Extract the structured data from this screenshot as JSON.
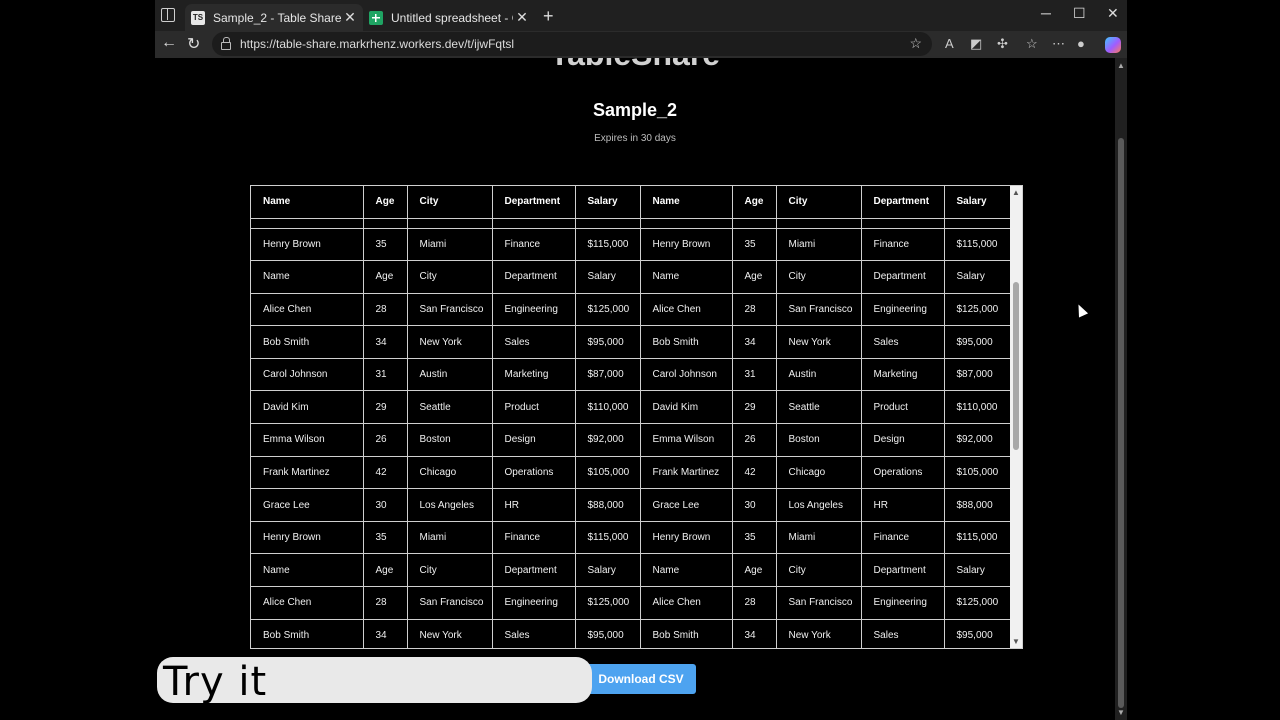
{
  "browser": {
    "tabs": [
      {
        "title": "Sample_2 - Table Share",
        "favicon": "table-share-favicon",
        "active": true
      },
      {
        "title": "Untitled spreadsheet - Google Sheets",
        "favicon": "google-sheets-favicon",
        "active": false
      }
    ],
    "new_tab": "+",
    "window_controls": {
      "minimize": "─",
      "maximize": "☐",
      "close": "✕"
    },
    "nav": {
      "back": "←",
      "reload": "↻"
    },
    "url": "https://table-share.markrhenz.workers.dev/t/ijwFqtsl",
    "star": "☆",
    "toolbar_icons": [
      "read-aloud-icon",
      "extension-icon",
      "puzzle-icon",
      "favorites-icon",
      "more-icon",
      "profile-icon",
      "copilot-icon"
    ]
  },
  "page": {
    "brand": "TableShare",
    "title": "Sample_2",
    "expires": "Expires in 30 days",
    "download_button": "Download CSV"
  },
  "table": {
    "headers": [
      "Name",
      "Age",
      "City",
      "Department",
      "Salary",
      "Name",
      "Age",
      "City",
      "Department",
      "Salary"
    ],
    "rows": [
      [
        "Henry Brown",
        "35",
        "Miami",
        "Finance",
        "$115,000",
        "Henry Brown",
        "35",
        "Miami",
        "Finance",
        "$115,000"
      ],
      [
        "Name",
        "Age",
        "City",
        "Department",
        "Salary",
        "Name",
        "Age",
        "City",
        "Department",
        "Salary"
      ],
      [
        "Alice Chen",
        "28",
        "San Francisco",
        "Engineering",
        "$125,000",
        "Alice Chen",
        "28",
        "San Francisco",
        "Engineering",
        "$125,000"
      ],
      [
        "Bob Smith",
        "34",
        "New York",
        "Sales",
        "$95,000",
        "Bob Smith",
        "34",
        "New York",
        "Sales",
        "$95,000"
      ],
      [
        "Carol Johnson",
        "31",
        "Austin",
        "Marketing",
        "$87,000",
        "Carol Johnson",
        "31",
        "Austin",
        "Marketing",
        "$87,000"
      ],
      [
        "David Kim",
        "29",
        "Seattle",
        "Product",
        "$110,000",
        "David Kim",
        "29",
        "Seattle",
        "Product",
        "$110,000"
      ],
      [
        "Emma Wilson",
        "26",
        "Boston",
        "Design",
        "$92,000",
        "Emma Wilson",
        "26",
        "Boston",
        "Design",
        "$92,000"
      ],
      [
        "Frank Martinez",
        "42",
        "Chicago",
        "Operations",
        "$105,000",
        "Frank Martinez",
        "42",
        "Chicago",
        "Operations",
        "$105,000"
      ],
      [
        "Grace Lee",
        "30",
        "Los Angeles",
        "HR",
        "$88,000",
        "Grace Lee",
        "30",
        "Los Angeles",
        "HR",
        "$88,000"
      ],
      [
        "Henry Brown",
        "35",
        "Miami",
        "Finance",
        "$115,000",
        "Henry Brown",
        "35",
        "Miami",
        "Finance",
        "$115,000"
      ],
      [
        "Name",
        "Age",
        "City",
        "Department",
        "Salary",
        "Name",
        "Age",
        "City",
        "Department",
        "Salary"
      ],
      [
        "Alice Chen",
        "28",
        "San Francisco",
        "Engineering",
        "$125,000",
        "Alice Chen",
        "28",
        "San Francisco",
        "Engineering",
        "$125,000"
      ],
      [
        "Bob Smith",
        "34",
        "New York",
        "Sales",
        "$95,000",
        "Bob Smith",
        "34",
        "New York",
        "Sales",
        "$95,000"
      ]
    ]
  },
  "overlay": {
    "text": "Try it"
  },
  "colors": {
    "page_background": "#000000",
    "button": "#4da3f0",
    "overlay": "#e9e9e9"
  }
}
